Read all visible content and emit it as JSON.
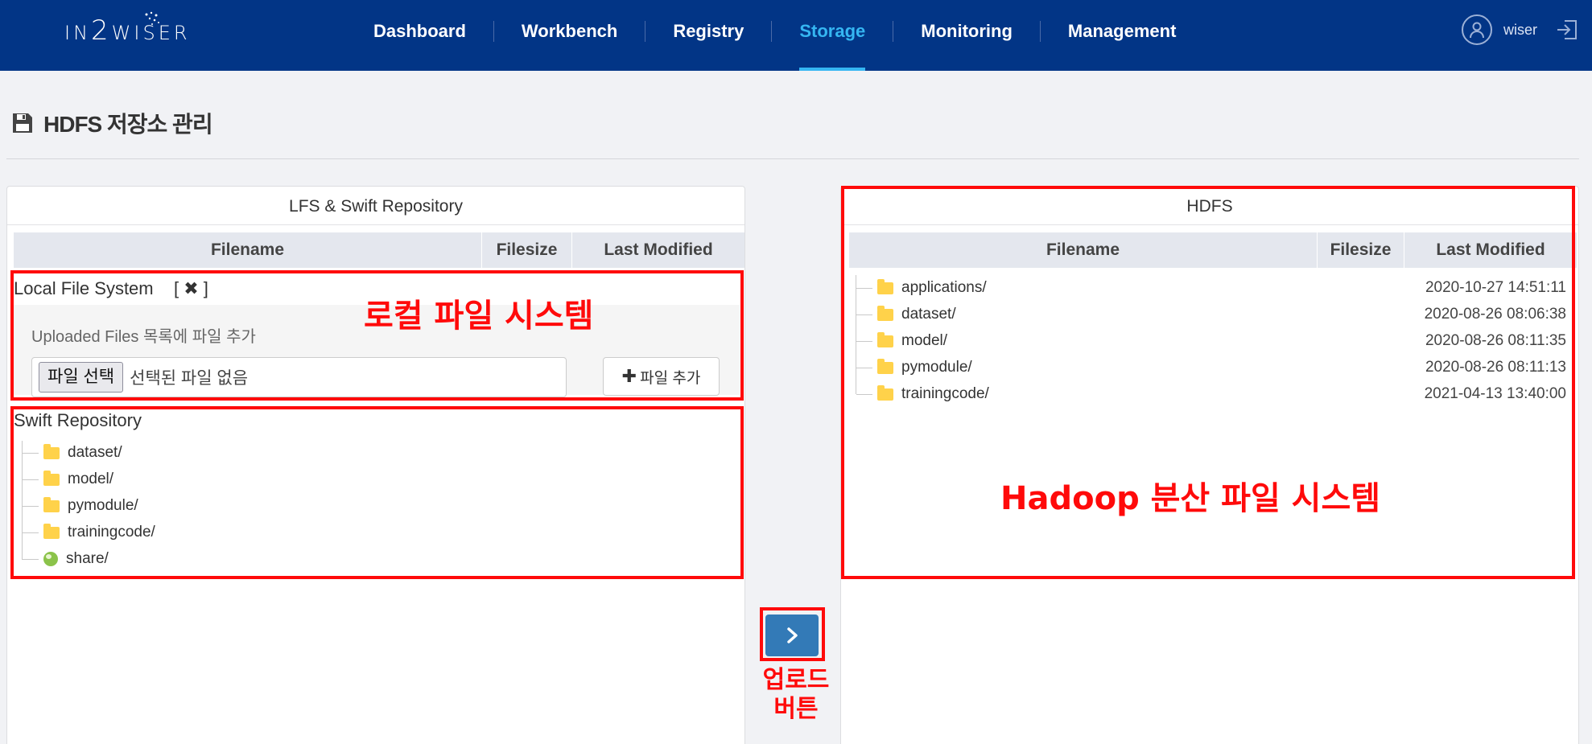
{
  "header": {
    "logo": "IN2WISER",
    "nav": [
      {
        "label": "Dashboard",
        "active": false
      },
      {
        "label": "Workbench",
        "active": false
      },
      {
        "label": "Registry",
        "active": false
      },
      {
        "label": "Storage",
        "active": true
      },
      {
        "label": "Monitoring",
        "active": false
      },
      {
        "label": "Management",
        "active": false
      }
    ],
    "user": "wiser"
  },
  "page": {
    "title": "HDFS 저장소 관리"
  },
  "left_panel": {
    "title": "LFS & Swift Repository",
    "columns": [
      "Filename",
      "Filesize",
      "Last Modified"
    ],
    "local": {
      "title": "Local File System",
      "clear_label": "[ ✖ ]",
      "hint": "Uploaded Files 목록에 파일 추가",
      "file_button": "파일 선택",
      "file_status": "선택된 파일 없음",
      "add_button": "파일 추가"
    },
    "swift": {
      "title": "Swift Repository",
      "items": [
        {
          "name": "dataset/",
          "icon": "folder-icon"
        },
        {
          "name": "model/",
          "icon": "folder-icon"
        },
        {
          "name": "pymodule/",
          "icon": "folder-icon"
        },
        {
          "name": "trainingcode/",
          "icon": "folder-icon"
        },
        {
          "name": "share/",
          "icon": "globe-icon"
        }
      ]
    }
  },
  "right_panel": {
    "title": "HDFS",
    "columns": [
      "Filename",
      "Filesize",
      "Last Modified"
    ],
    "items": [
      {
        "name": "applications/",
        "modified": "2020-10-27 14:51:11"
      },
      {
        "name": "dataset/",
        "modified": "2020-08-26 08:06:38"
      },
      {
        "name": "model/",
        "modified": "2020-08-26 08:11:35"
      },
      {
        "name": "pymodule/",
        "modified": "2020-08-26 08:11:13"
      },
      {
        "name": "trainingcode/",
        "modified": "2021-04-13 13:40:00"
      }
    ]
  },
  "annotations": {
    "local": "로컬 파일 시스템",
    "hdfs": "Hadoop 분산 파일 시스템",
    "upload_line1": "업로드",
    "upload_line2": "버튼"
  },
  "colors": {
    "topbar": "#023586",
    "active_nav": "#35b6f2",
    "annotation_red": "#ff0a0a",
    "upload_button": "#337ab7",
    "folder": "#ffd24a"
  }
}
